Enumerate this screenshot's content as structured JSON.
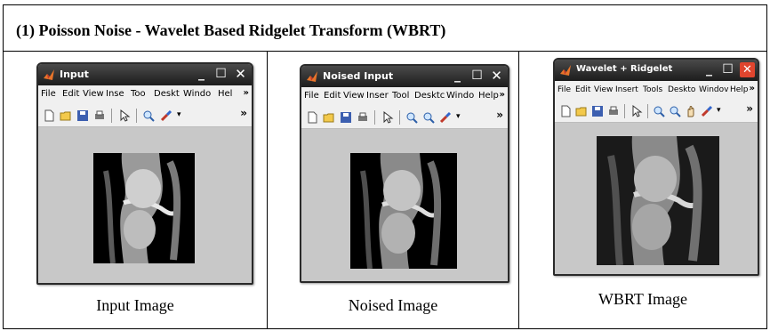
{
  "title": "(1) Poisson Noise - Wavelet Based Ridgelet Transform  (WBRT)",
  "panels": [
    {
      "window_title": "Input",
      "menu": [
        "File",
        "Edit",
        "View",
        "Inse",
        "Too",
        "Deskt",
        "Windo",
        "Hel"
      ],
      "caption": "Input Image"
    },
    {
      "window_title": "Noised Input",
      "menu": [
        "File",
        "Edit",
        "View",
        "Inser",
        "Tool",
        "Desktc",
        "Windo",
        "Help"
      ],
      "caption": "Noised Image"
    },
    {
      "window_title": "Wavelet + Ridgelet",
      "menu": [
        "File",
        "Edit",
        "View",
        "Insert",
        "Tools",
        "Deskto",
        "Windov",
        "Help"
      ],
      "caption": "WBRT Image"
    }
  ],
  "window_buttons": {
    "minimize": "_",
    "maximize": "☐",
    "close": "✕"
  },
  "menu_overflow": "»",
  "toolbar_overflow": "»",
  "colors": {
    "titlebar": "#2b2b2b",
    "canvas": "#c8c8c8",
    "close_active": "#e0452e"
  },
  "icons": [
    "matlab-icon",
    "new-file-icon",
    "open-folder-icon",
    "save-icon",
    "print-icon",
    "pointer-icon",
    "zoom-in-icon",
    "zoom-out-icon",
    "pan-icon",
    "data-cursor-icon"
  ]
}
